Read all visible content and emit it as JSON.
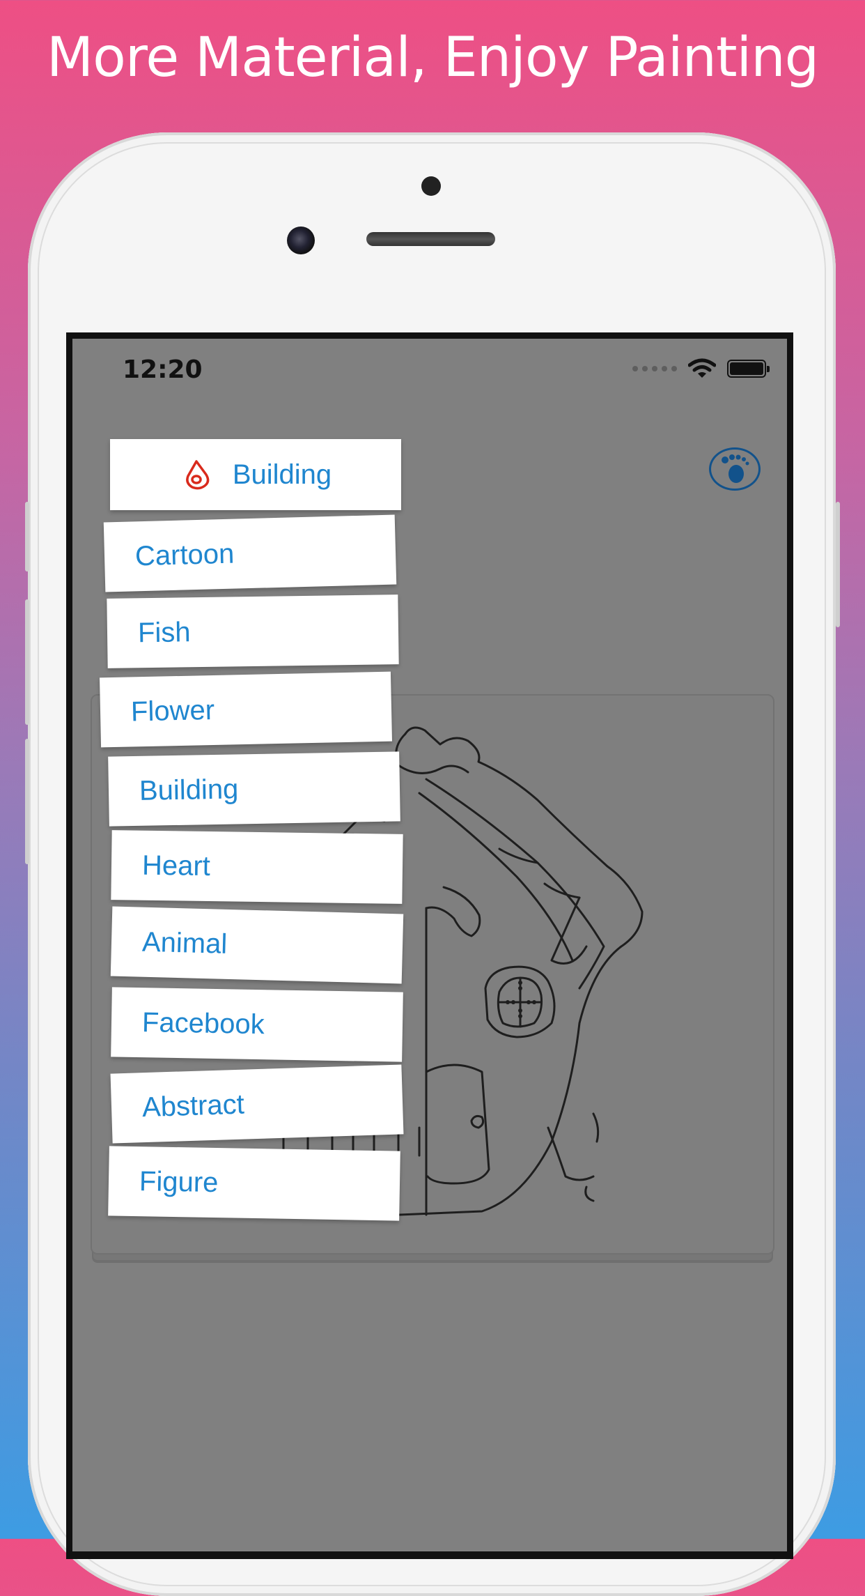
{
  "headline": "More Material, Enjoy Painting",
  "status_bar": {
    "time": "12:20"
  },
  "category_menu": {
    "selected": "Building",
    "items": [
      "Cartoon",
      "Fish",
      "Flower",
      "Building",
      "Heart",
      "Animal",
      "Facebook",
      "Abstract",
      "Figure"
    ]
  },
  "icons": {
    "selected_category": "drop-icon",
    "top_right": "footprint-icon",
    "status": [
      "signal-dots-icon",
      "wifi-icon",
      "battery-icon"
    ]
  },
  "colors": {
    "label_blue": "#1f86cf",
    "drop_red": "#d92a1c",
    "foot_blue": "#12528b",
    "screen_gray": "#808080"
  }
}
